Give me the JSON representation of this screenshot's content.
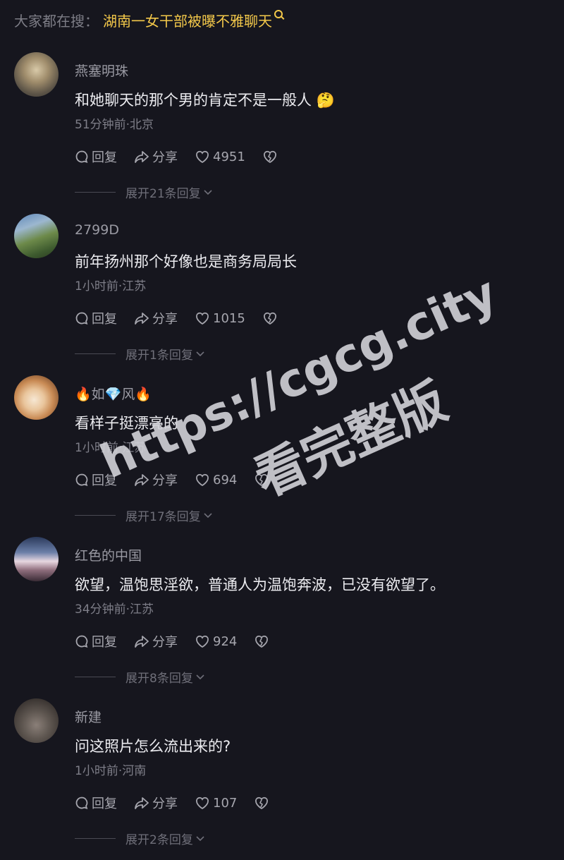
{
  "search": {
    "prefix": "大家都在搜：",
    "term": "湖南一女干部被曝不雅聊天",
    "icon": "search-icon"
  },
  "actions": {
    "reply_label": "回复",
    "share_label": "分享"
  },
  "comments": [
    {
      "username": "燕塞明珠",
      "text": "和她聊天的那个男的肯定不是一般人",
      "emoji": "🤔",
      "meta": "51分钟前·北京",
      "likes": "4951",
      "expand": "展开21条回复"
    },
    {
      "username": "2799D",
      "text": "前年扬州那个好像也是商务局局长",
      "emoji": "",
      "meta": "1小时前·江苏",
      "likes": "1015",
      "expand": "展开1条回复"
    },
    {
      "username": "🔥如💎风🔥",
      "text": "看样子挺漂亮的",
      "emoji": "",
      "meta": "1小时前·江苏",
      "likes": "694",
      "expand": "展开17条回复"
    },
    {
      "username": "红色的中国",
      "text": "欲望，温饱思淫欲，普通人为温饱奔波，已没有欲望了。",
      "emoji": "",
      "meta": "34分钟前·江苏",
      "likes": "924",
      "expand": "展开8条回复"
    },
    {
      "username": "新建",
      "text": "问这照片怎么流出来的?",
      "emoji": "",
      "meta": "1小时前·河南",
      "likes": "107",
      "expand": "展开2条回复"
    }
  ],
  "watermark": {
    "line1": "https://cgcg.city",
    "line2": "看完整版"
  }
}
